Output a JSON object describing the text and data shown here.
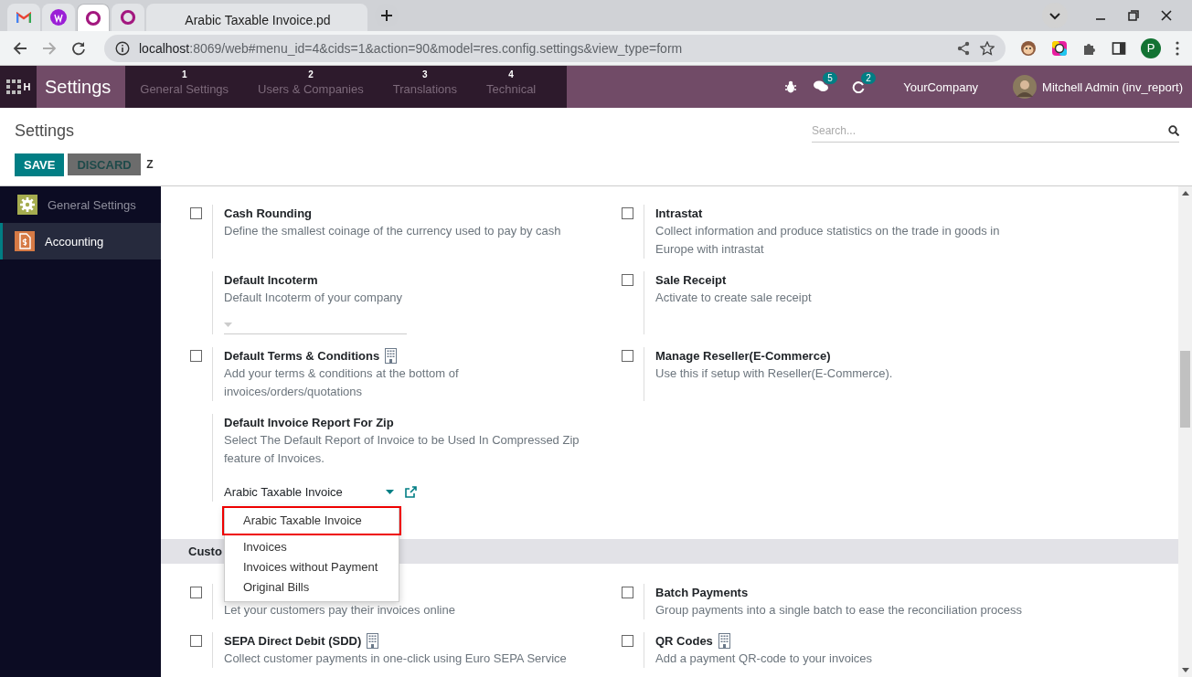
{
  "browser": {
    "tabs": [
      {
        "kind": "gmail",
        "selected": false
      },
      {
        "kind": "w",
        "selected": false
      },
      {
        "kind": "odoo",
        "selected": true
      },
      {
        "kind": "odoo",
        "selected": false
      },
      {
        "kind": "page",
        "title": "Arabic Taxable Invoice.pd",
        "selected": false
      }
    ],
    "url_host": "localhost",
    "url_rest": ":8069/web#menu_id=4&cids=1&action=90&model=res.config.settings&view_type=form",
    "profile_initial": "P"
  },
  "navbar": {
    "apps_hotkey": "H",
    "app_name": "Settings",
    "menu": [
      {
        "label": "General Settings",
        "hotkey": "1"
      },
      {
        "label": "Users & Companies",
        "hotkey": "2"
      },
      {
        "label": "Translations",
        "hotkey": "3"
      },
      {
        "label": "Technical",
        "hotkey": "4"
      }
    ],
    "messages_count": "5",
    "activities_count": "2",
    "company": "YourCompany",
    "user": "Mitchell Admin (inv_report)"
  },
  "control_panel": {
    "title": "Settings",
    "search_placeholder": "Search...",
    "save": "SAVE",
    "discard": "DISCARD",
    "discard_hotkey": "Z"
  },
  "sidebar": [
    {
      "label": "General Settings",
      "kind": "gear",
      "selected": false
    },
    {
      "label": "Accounting",
      "kind": "invoice",
      "selected": true
    }
  ],
  "rows": [
    {
      "left": {
        "kind": "checkbox",
        "checked": false,
        "title": "Cash Rounding",
        "description": "Define the smallest coinage of the currency used to pay by cash"
      },
      "right": {
        "kind": "checkbox",
        "checked": false,
        "title": "Intrastat",
        "description": "Collect information and produce statistics on the trade in goods in Europe with intrastat"
      }
    },
    {
      "left": {
        "kind": "select",
        "title": "Default Incoterm",
        "description": "Default Incoterm of your company"
      },
      "right": {
        "kind": "checkbox",
        "checked": false,
        "title": "Sale Receipt",
        "description": "Activate to create sale receipt"
      }
    },
    {
      "left": {
        "kind": "checkbox",
        "checked": false,
        "enterprise": true,
        "title": "Default Terms & Conditions",
        "description": "Add your terms & conditions at the bottom of invoices/orders/quotations"
      },
      "right": {
        "kind": "checkbox",
        "checked": false,
        "title": "Manage Reseller(E-Commerce)",
        "description": "Use this if setup with Reseller(E-Commerce)."
      }
    },
    {
      "left": {
        "kind": "select",
        "title": "Default Invoice Report For Zip",
        "description": "Select The Default Report of Invoice to be Used In Compressed Zip feature of Invoices.",
        "value": "Arabic Taxable Invoice",
        "external_link": true,
        "options": [
          {
            "label": "Arabic Taxable Invoice",
            "selected": true
          },
          {
            "label": "Invoices",
            "selected": false
          },
          {
            "label": "Invoices without Payment",
            "selected": false
          },
          {
            "label": "Original Bills",
            "selected": false
          }
        ]
      }
    }
  ],
  "section": "Custo",
  "rows2": [
    {
      "left": {
        "kind": "checkbox",
        "checked": false,
        "description": "Let your customers pay their invoices online"
      },
      "right": {
        "kind": "checkbox",
        "checked": false,
        "title": "Batch Payments",
        "description": "Group payments into a single batch to ease the reconciliation process"
      }
    },
    {
      "left": {
        "kind": "checkbox",
        "checked": false,
        "enterprise": true,
        "title": "SEPA Direct Debit (SDD)",
        "description": "Collect customer payments in one-click using Euro SEPA Service"
      },
      "right": {
        "kind": "checkbox",
        "checked": false,
        "enterprise": true,
        "title": "QR Codes",
        "description": "Add a payment QR-code to your invoices"
      }
    }
  ]
}
